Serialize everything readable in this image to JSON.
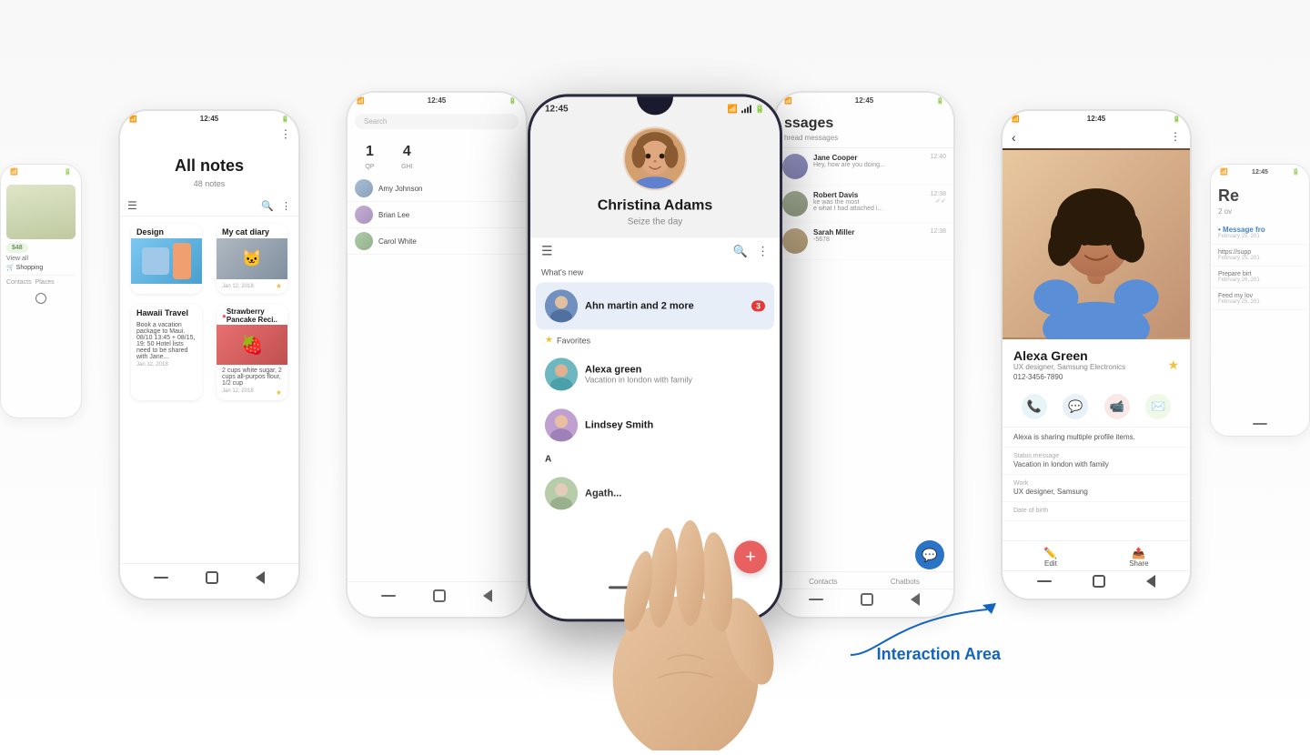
{
  "scene": {
    "background": "#f8f8f8"
  },
  "main_phone": {
    "status": {
      "time": "12:45",
      "signal": "signal",
      "wifi": "wifi",
      "battery": "battery"
    },
    "contact": {
      "name": "Christina  Adams",
      "subtitle": "Seize the day"
    },
    "contacts_screen": {
      "whats_new": "What's new",
      "item_highlighted": {
        "name": "Ahn martin and 2 more",
        "badge": "3"
      },
      "favorites_label": "Favorites",
      "item_alexa": {
        "name": "Alexa green",
        "sub": "Vacation in london with family"
      },
      "item_lindsey": {
        "name": "Lindsey Smith"
      },
      "section_a": "A",
      "item_agatha": {
        "name": "Agath..."
      }
    },
    "nav": {
      "back": "back",
      "home": "home",
      "recents": "recents"
    }
  },
  "notes_phone": {
    "status_time": "12:45",
    "title": "All notes",
    "count": "48 notes",
    "note1_title": "Design",
    "note2_title": "My cat diary",
    "note3_title": "Hawaii Travel",
    "note3_body": "Book a vacation package to Maui. 08/10 13:45 + 08/15, 19: 50 Hotel lists need to be shared with Jane...",
    "note4_title": "Strawberry Pancake Reci..",
    "note4_body": "2 cups white sugar, 2 cups all-purpos flour, 1/2 cup",
    "note2_date": "Jan 12, 2018",
    "note3_date": "Jan 12, 2018",
    "note4_date": "Jan 12, 2018"
  },
  "contacts_bg_phone": {
    "status_time": "12:45",
    "search_placeholder": "Search",
    "num1": "1",
    "num1_label": "QP",
    "num4": "4",
    "num4_label": "GHI"
  },
  "messages_bg_phone": {
    "status_time": "12:45",
    "title": "ssages",
    "subtitle": "hread messages",
    "msg1_time": "12:40",
    "msg2_time": "12:38",
    "msg2_preview": "ke was the most",
    "msg2_preview2": "e what I had attached i...",
    "phone_number": "-5678",
    "msg3_time": "12:38"
  },
  "profile_phone": {
    "status_time": "12:45",
    "name": "Alexa Green",
    "title": "UX designer, Samsung Electronics",
    "phone": "012-3456-7890",
    "status_msg_label": "Alexa is sharing multiple profile items.",
    "status_msg_title": "Status message",
    "status_msg": "Vacation in london with family",
    "work_label": "Work",
    "work": "UX designer, Samsung",
    "dob_label": "Date of birth",
    "edit_label": "Edit",
    "share_label": "Share"
  },
  "rightmost_phone": {
    "status_time": "12:45",
    "title": "Re",
    "count": "2 ov",
    "msg1_sender": "• Message fro",
    "msg1_date": "February 25, 201",
    "msg2_link": "https://supp",
    "msg2_date": "February 25, 201",
    "msg3_title": "Prepare birt",
    "msg3_date": "February 26, 201",
    "msg4_title": "Feed my lov",
    "msg4_date": "February 25, 201"
  },
  "interaction_area": {
    "label": "Interaction Area"
  }
}
